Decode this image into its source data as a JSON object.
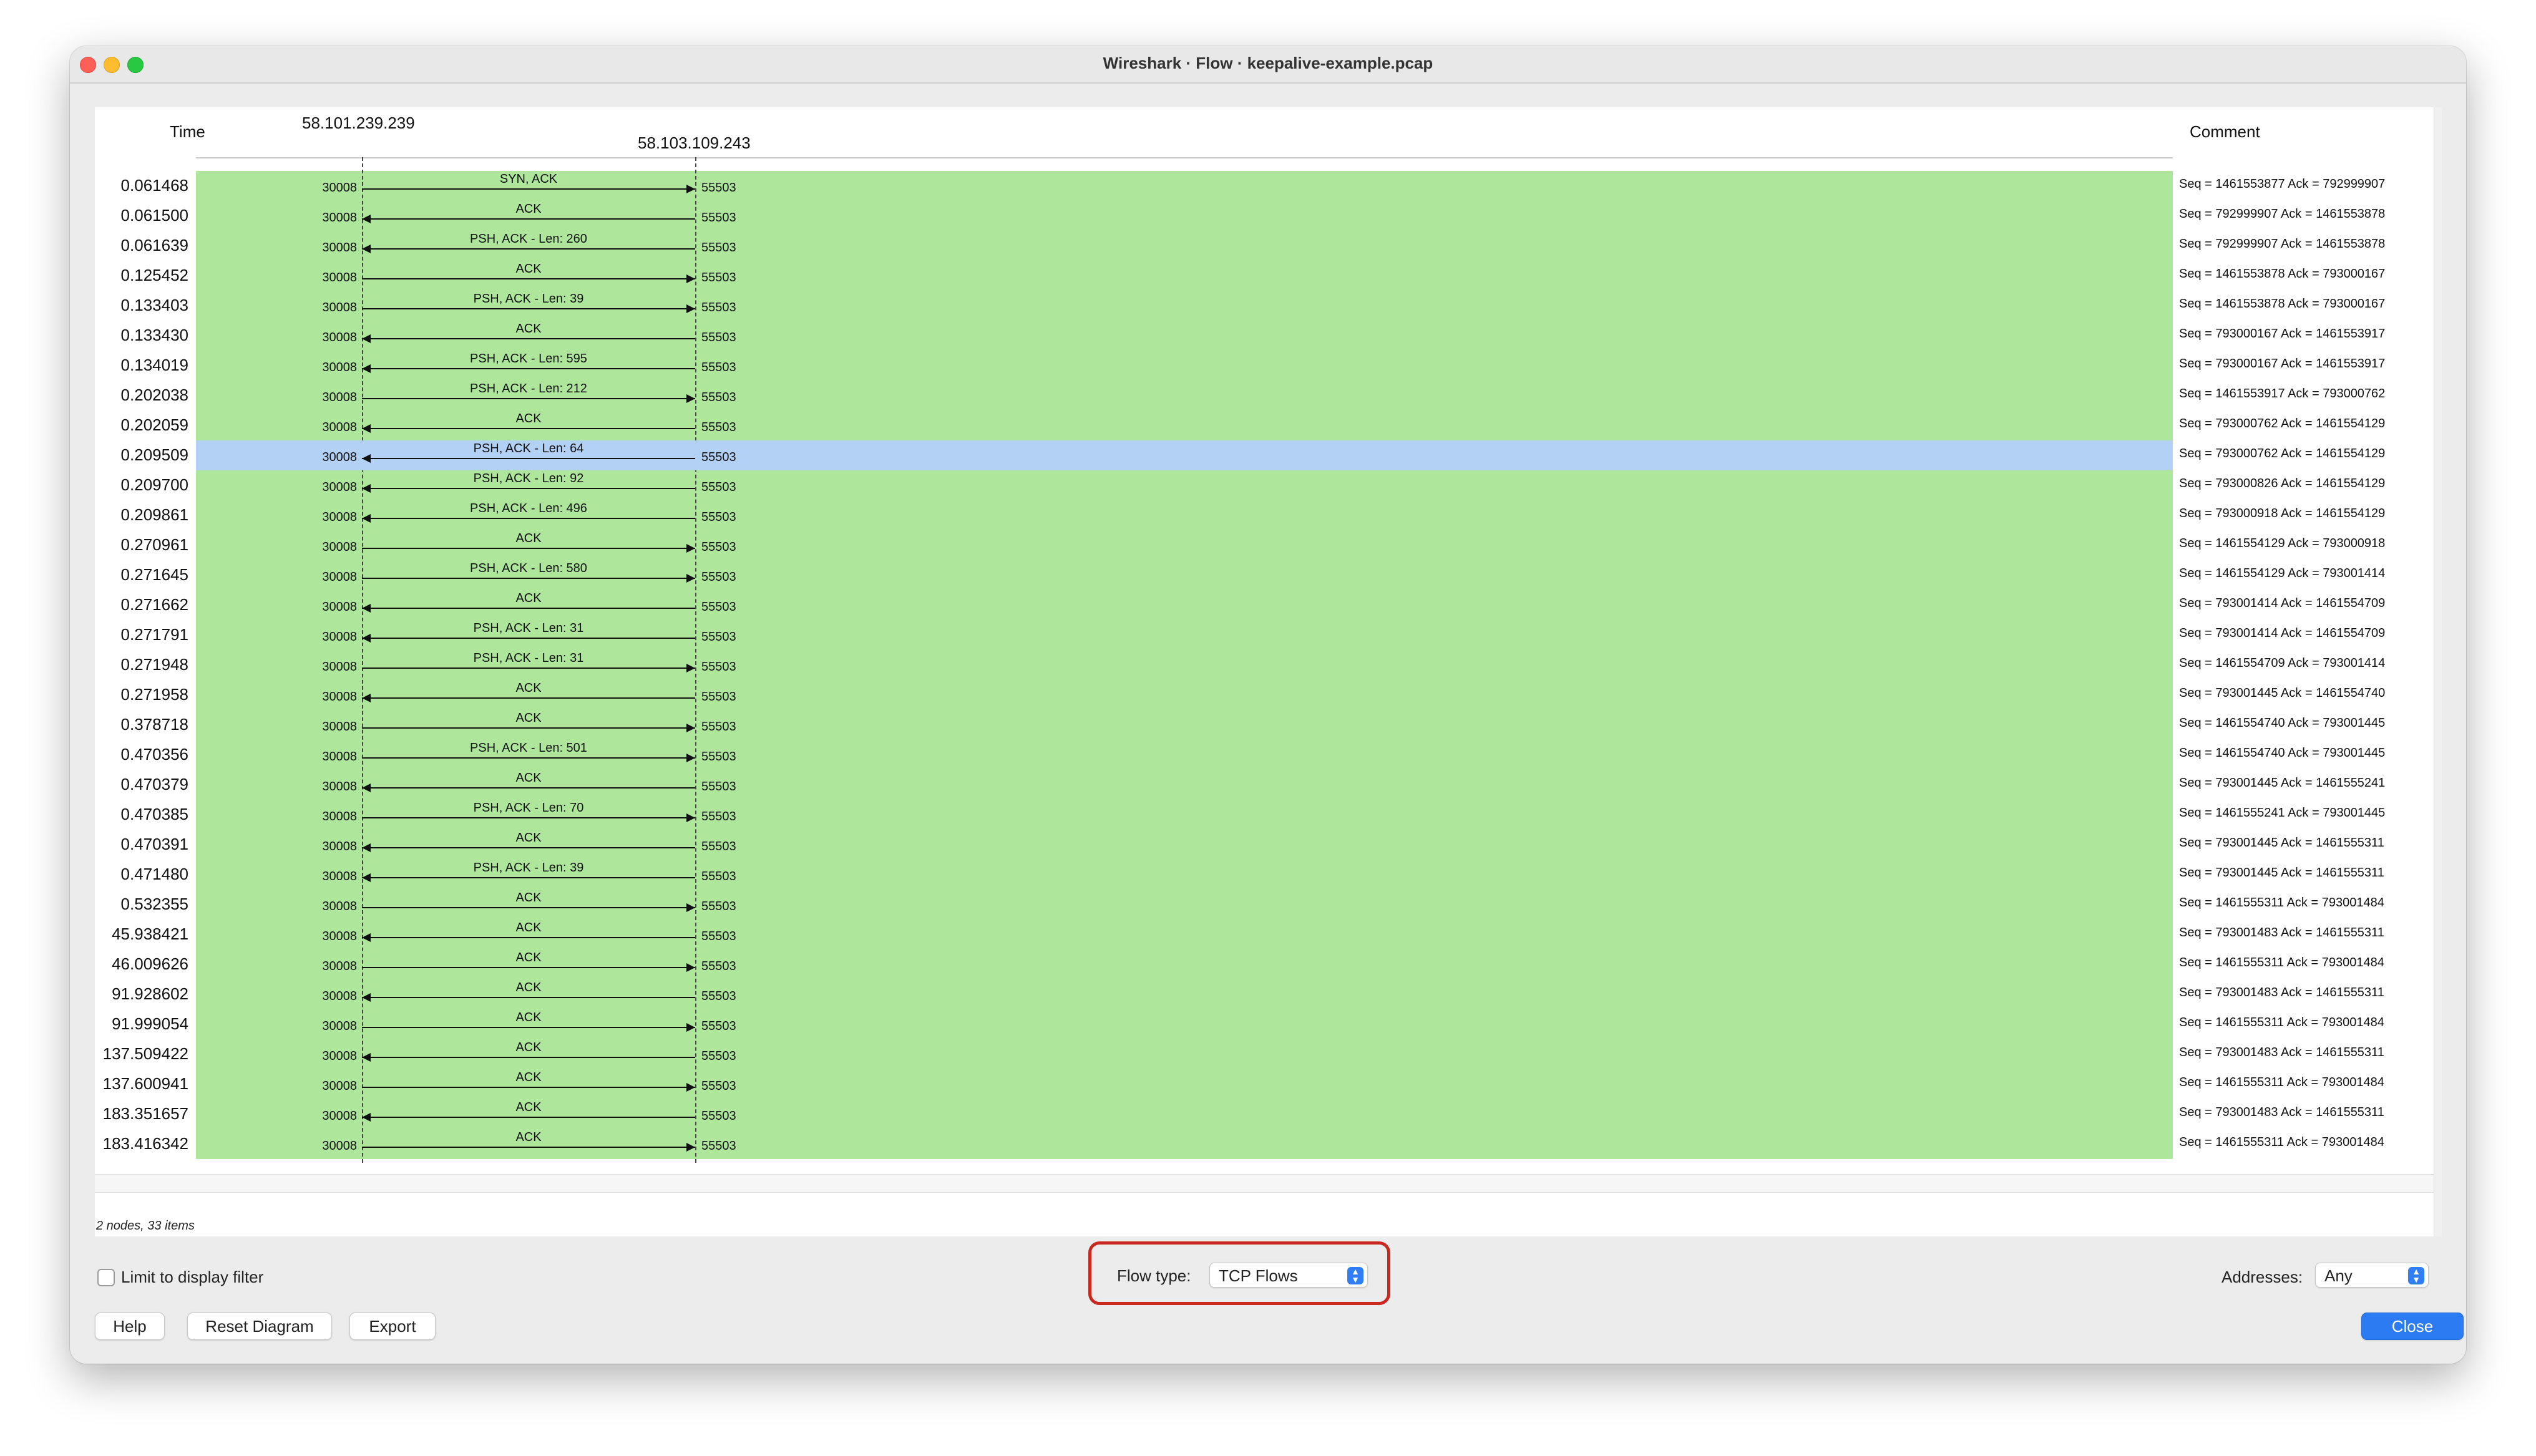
{
  "window": {
    "title": "Wireshark · Flow · keepalive-example.pcap"
  },
  "headers": {
    "time": "Time",
    "comment": "Comment"
  },
  "nodes": {
    "a": "58.101.239.239",
    "b": "58.103.109.243"
  },
  "ports": {
    "a": "30008",
    "b": "55503"
  },
  "selected_index": 9,
  "rows": [
    {
      "time": "0.061468",
      "label": "SYN, ACK",
      "dir": "r",
      "comment": "Seq = 1461553877 Ack = 792999907"
    },
    {
      "time": "0.061500",
      "label": "ACK",
      "dir": "l",
      "comment": "Seq = 792999907 Ack = 1461553878"
    },
    {
      "time": "0.061639",
      "label": "PSH, ACK - Len: 260",
      "dir": "l",
      "comment": "Seq = 792999907 Ack = 1461553878"
    },
    {
      "time": "0.125452",
      "label": "ACK",
      "dir": "r",
      "comment": "Seq = 1461553878 Ack = 793000167"
    },
    {
      "time": "0.133403",
      "label": "PSH, ACK - Len: 39",
      "dir": "r",
      "comment": "Seq = 1461553878 Ack = 793000167"
    },
    {
      "time": "0.133430",
      "label": "ACK",
      "dir": "l",
      "comment": "Seq = 793000167 Ack = 1461553917"
    },
    {
      "time": "0.134019",
      "label": "PSH, ACK - Len: 595",
      "dir": "l",
      "comment": "Seq = 793000167 Ack = 1461553917"
    },
    {
      "time": "0.202038",
      "label": "PSH, ACK - Len: 212",
      "dir": "r",
      "comment": "Seq = 1461553917 Ack = 793000762"
    },
    {
      "time": "0.202059",
      "label": "ACK",
      "dir": "l",
      "comment": "Seq = 793000762 Ack = 1461554129"
    },
    {
      "time": "0.209509",
      "label": "PSH, ACK - Len: 64",
      "dir": "l",
      "comment": "Seq = 793000762 Ack = 1461554129"
    },
    {
      "time": "0.209700",
      "label": "PSH, ACK - Len: 92",
      "dir": "l",
      "comment": "Seq = 793000826 Ack = 1461554129"
    },
    {
      "time": "0.209861",
      "label": "PSH, ACK - Len: 496",
      "dir": "l",
      "comment": "Seq = 793000918 Ack = 1461554129"
    },
    {
      "time": "0.270961",
      "label": "ACK",
      "dir": "r",
      "comment": "Seq = 1461554129 Ack = 793000918"
    },
    {
      "time": "0.271645",
      "label": "PSH, ACK - Len: 580",
      "dir": "r",
      "comment": "Seq = 1461554129 Ack = 793001414"
    },
    {
      "time": "0.271662",
      "label": "ACK",
      "dir": "l",
      "comment": "Seq = 793001414 Ack = 1461554709"
    },
    {
      "time": "0.271791",
      "label": "PSH, ACK - Len: 31",
      "dir": "l",
      "comment": "Seq = 793001414 Ack = 1461554709"
    },
    {
      "time": "0.271948",
      "label": "PSH, ACK - Len: 31",
      "dir": "r",
      "comment": "Seq = 1461554709 Ack = 793001414"
    },
    {
      "time": "0.271958",
      "label": "ACK",
      "dir": "l",
      "comment": "Seq = 793001445 Ack = 1461554740"
    },
    {
      "time": "0.378718",
      "label": "ACK",
      "dir": "r",
      "comment": "Seq = 1461554740 Ack = 793001445"
    },
    {
      "time": "0.470356",
      "label": "PSH, ACK - Len: 501",
      "dir": "r",
      "comment": "Seq = 1461554740 Ack = 793001445"
    },
    {
      "time": "0.470379",
      "label": "ACK",
      "dir": "l",
      "comment": "Seq = 793001445 Ack = 1461555241"
    },
    {
      "time": "0.470385",
      "label": "PSH, ACK - Len: 70",
      "dir": "r",
      "comment": "Seq = 1461555241 Ack = 793001445"
    },
    {
      "time": "0.470391",
      "label": "ACK",
      "dir": "l",
      "comment": "Seq = 793001445 Ack = 1461555311"
    },
    {
      "time": "0.471480",
      "label": "PSH, ACK - Len: 39",
      "dir": "l",
      "comment": "Seq = 793001445 Ack = 1461555311"
    },
    {
      "time": "0.532355",
      "label": "ACK",
      "dir": "r",
      "comment": "Seq = 1461555311 Ack = 793001484"
    },
    {
      "time": "45.938421",
      "label": "ACK",
      "dir": "l",
      "comment": "Seq = 793001483 Ack = 1461555311"
    },
    {
      "time": "46.009626",
      "label": "ACK",
      "dir": "r",
      "comment": "Seq = 1461555311 Ack = 793001484"
    },
    {
      "time": "91.928602",
      "label": "ACK",
      "dir": "l",
      "comment": "Seq = 793001483 Ack = 1461555311"
    },
    {
      "time": "91.999054",
      "label": "ACK",
      "dir": "r",
      "comment": "Seq = 1461555311 Ack = 793001484"
    },
    {
      "time": "137.509422",
      "label": "ACK",
      "dir": "l",
      "comment": "Seq = 793001483 Ack = 1461555311"
    },
    {
      "time": "137.600941",
      "label": "ACK",
      "dir": "r",
      "comment": "Seq = 1461555311 Ack = 793001484"
    },
    {
      "time": "183.351657",
      "label": "ACK",
      "dir": "l",
      "comment": "Seq = 793001483 Ack = 1461555311"
    },
    {
      "time": "183.416342",
      "label": "ACK",
      "dir": "r",
      "comment": "Seq = 1461555311 Ack = 793001484"
    }
  ],
  "status": {
    "text": "2 nodes, 33 items"
  },
  "controls": {
    "limit_label": "Limit to display filter",
    "limit_checked": false,
    "flow_type_label": "Flow type:",
    "flow_type_value": "TCP Flows",
    "addresses_label": "Addresses:",
    "addresses_value": "Any"
  },
  "buttons": {
    "help": "Help",
    "reset": "Reset Diagram",
    "export": "Export",
    "close": "Close"
  },
  "colors": {
    "row_bg": "#aee79c",
    "selected_bg": "#b3d0f5",
    "highlight_border": "#c8281e",
    "accent": "#2b7cf3"
  }
}
